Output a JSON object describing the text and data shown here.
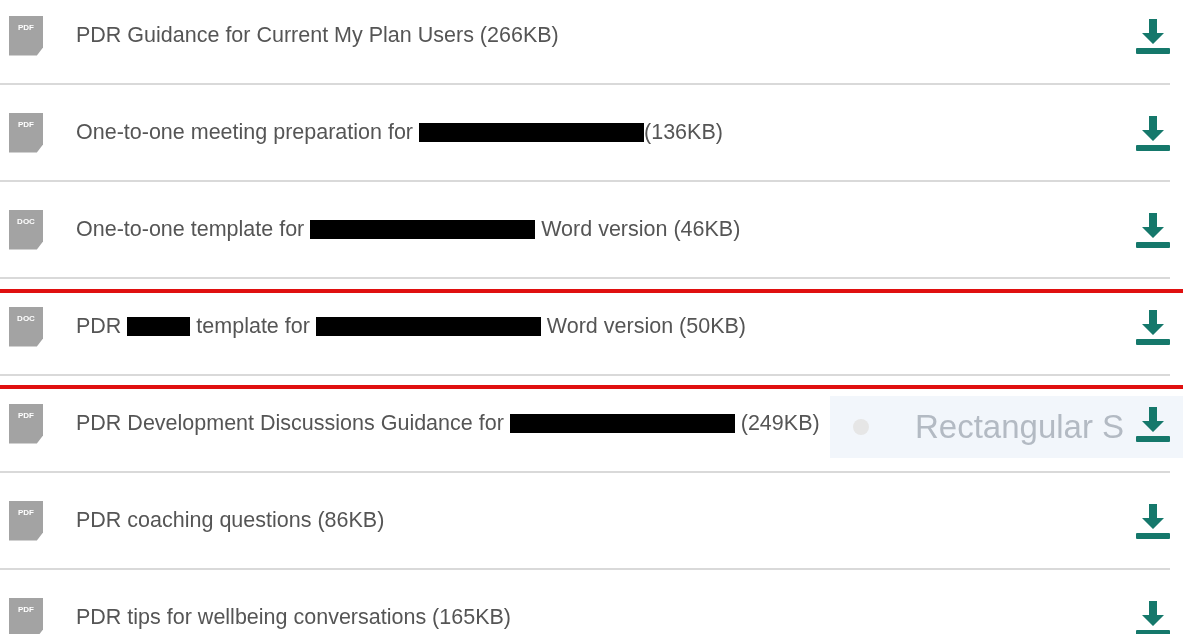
{
  "documents": [
    {
      "file_type": "PDF",
      "highlighted": false,
      "parts": [
        {
          "kind": "text",
          "text": "PDR Guidance for Current My Plan Users (266KB)"
        }
      ]
    },
    {
      "file_type": "PDF",
      "highlighted": false,
      "parts": [
        {
          "kind": "text",
          "text": "One-to-one meeting preparation for "
        },
        {
          "kind": "redaction"
        },
        {
          "kind": "text",
          "text": "(136KB)"
        }
      ]
    },
    {
      "file_type": "DOC",
      "highlighted": false,
      "parts": [
        {
          "kind": "text",
          "text": "One-to-one template for "
        },
        {
          "kind": "redaction"
        },
        {
          "kind": "text",
          "text": " Word version (46KB)"
        }
      ]
    },
    {
      "file_type": "DOC",
      "highlighted": true,
      "parts": [
        {
          "kind": "text",
          "text": "PDR "
        },
        {
          "kind": "short_redaction"
        },
        {
          "kind": "text",
          "text": " template for "
        },
        {
          "kind": "redaction"
        },
        {
          "kind": "text",
          "text": " Word version (50KB)"
        }
      ]
    },
    {
      "file_type": "PDF",
      "highlighted": false,
      "parts": [
        {
          "kind": "text",
          "text": "PDR Development Discussions Guidance for "
        },
        {
          "kind": "redaction"
        },
        {
          "kind": "text",
          "text": " (249KB)"
        }
      ],
      "overlay": {
        "text": "Rectangular S"
      }
    },
    {
      "file_type": "PDF",
      "highlighted": false,
      "parts": [
        {
          "kind": "text",
          "text": "PDR coaching questions (86KB)"
        }
      ]
    },
    {
      "file_type": "PDF",
      "highlighted": false,
      "parts": [
        {
          "kind": "text",
          "text": "PDR tips for wellbeing conversations (165KB)"
        }
      ]
    }
  ]
}
